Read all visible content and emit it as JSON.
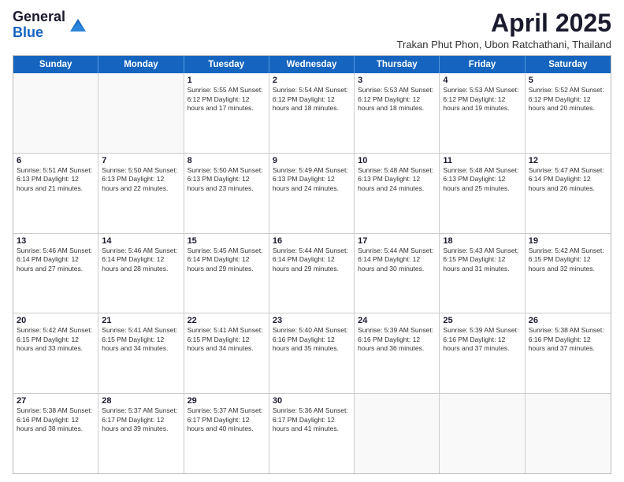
{
  "logo": {
    "general": "General",
    "blue": "Blue"
  },
  "title": "April 2025",
  "location": "Trakan Phut Phon, Ubon Ratchathani, Thailand",
  "weekdays": [
    "Sunday",
    "Monday",
    "Tuesday",
    "Wednesday",
    "Thursday",
    "Friday",
    "Saturday"
  ],
  "weeks": [
    [
      {
        "day": "",
        "info": ""
      },
      {
        "day": "",
        "info": ""
      },
      {
        "day": "1",
        "info": "Sunrise: 5:55 AM\nSunset: 6:12 PM\nDaylight: 12 hours and 17 minutes."
      },
      {
        "day": "2",
        "info": "Sunrise: 5:54 AM\nSunset: 6:12 PM\nDaylight: 12 hours and 18 minutes."
      },
      {
        "day": "3",
        "info": "Sunrise: 5:53 AM\nSunset: 6:12 PM\nDaylight: 12 hours and 18 minutes."
      },
      {
        "day": "4",
        "info": "Sunrise: 5:53 AM\nSunset: 6:12 PM\nDaylight: 12 hours and 19 minutes."
      },
      {
        "day": "5",
        "info": "Sunrise: 5:52 AM\nSunset: 6:12 PM\nDaylight: 12 hours and 20 minutes."
      }
    ],
    [
      {
        "day": "6",
        "info": "Sunrise: 5:51 AM\nSunset: 6:13 PM\nDaylight: 12 hours and 21 minutes."
      },
      {
        "day": "7",
        "info": "Sunrise: 5:50 AM\nSunset: 6:13 PM\nDaylight: 12 hours and 22 minutes."
      },
      {
        "day": "8",
        "info": "Sunrise: 5:50 AM\nSunset: 6:13 PM\nDaylight: 12 hours and 23 minutes."
      },
      {
        "day": "9",
        "info": "Sunrise: 5:49 AM\nSunset: 6:13 PM\nDaylight: 12 hours and 24 minutes."
      },
      {
        "day": "10",
        "info": "Sunrise: 5:48 AM\nSunset: 6:13 PM\nDaylight: 12 hours and 24 minutes."
      },
      {
        "day": "11",
        "info": "Sunrise: 5:48 AM\nSunset: 6:13 PM\nDaylight: 12 hours and 25 minutes."
      },
      {
        "day": "12",
        "info": "Sunrise: 5:47 AM\nSunset: 6:14 PM\nDaylight: 12 hours and 26 minutes."
      }
    ],
    [
      {
        "day": "13",
        "info": "Sunrise: 5:46 AM\nSunset: 6:14 PM\nDaylight: 12 hours and 27 minutes."
      },
      {
        "day": "14",
        "info": "Sunrise: 5:46 AM\nSunset: 6:14 PM\nDaylight: 12 hours and 28 minutes."
      },
      {
        "day": "15",
        "info": "Sunrise: 5:45 AM\nSunset: 6:14 PM\nDaylight: 12 hours and 29 minutes."
      },
      {
        "day": "16",
        "info": "Sunrise: 5:44 AM\nSunset: 6:14 PM\nDaylight: 12 hours and 29 minutes."
      },
      {
        "day": "17",
        "info": "Sunrise: 5:44 AM\nSunset: 6:14 PM\nDaylight: 12 hours and 30 minutes."
      },
      {
        "day": "18",
        "info": "Sunrise: 5:43 AM\nSunset: 6:15 PM\nDaylight: 12 hours and 31 minutes."
      },
      {
        "day": "19",
        "info": "Sunrise: 5:42 AM\nSunset: 6:15 PM\nDaylight: 12 hours and 32 minutes."
      }
    ],
    [
      {
        "day": "20",
        "info": "Sunrise: 5:42 AM\nSunset: 6:15 PM\nDaylight: 12 hours and 33 minutes."
      },
      {
        "day": "21",
        "info": "Sunrise: 5:41 AM\nSunset: 6:15 PM\nDaylight: 12 hours and 34 minutes."
      },
      {
        "day": "22",
        "info": "Sunrise: 5:41 AM\nSunset: 6:15 PM\nDaylight: 12 hours and 34 minutes."
      },
      {
        "day": "23",
        "info": "Sunrise: 5:40 AM\nSunset: 6:16 PM\nDaylight: 12 hours and 35 minutes."
      },
      {
        "day": "24",
        "info": "Sunrise: 5:39 AM\nSunset: 6:16 PM\nDaylight: 12 hours and 36 minutes."
      },
      {
        "day": "25",
        "info": "Sunrise: 5:39 AM\nSunset: 6:16 PM\nDaylight: 12 hours and 37 minutes."
      },
      {
        "day": "26",
        "info": "Sunrise: 5:38 AM\nSunset: 6:16 PM\nDaylight: 12 hours and 37 minutes."
      }
    ],
    [
      {
        "day": "27",
        "info": "Sunrise: 5:38 AM\nSunset: 6:16 PM\nDaylight: 12 hours and 38 minutes."
      },
      {
        "day": "28",
        "info": "Sunrise: 5:37 AM\nSunset: 6:17 PM\nDaylight: 12 hours and 39 minutes."
      },
      {
        "day": "29",
        "info": "Sunrise: 5:37 AM\nSunset: 6:17 PM\nDaylight: 12 hours and 40 minutes."
      },
      {
        "day": "30",
        "info": "Sunrise: 5:36 AM\nSunset: 6:17 PM\nDaylight: 12 hours and 41 minutes."
      },
      {
        "day": "",
        "info": ""
      },
      {
        "day": "",
        "info": ""
      },
      {
        "day": "",
        "info": ""
      }
    ]
  ]
}
